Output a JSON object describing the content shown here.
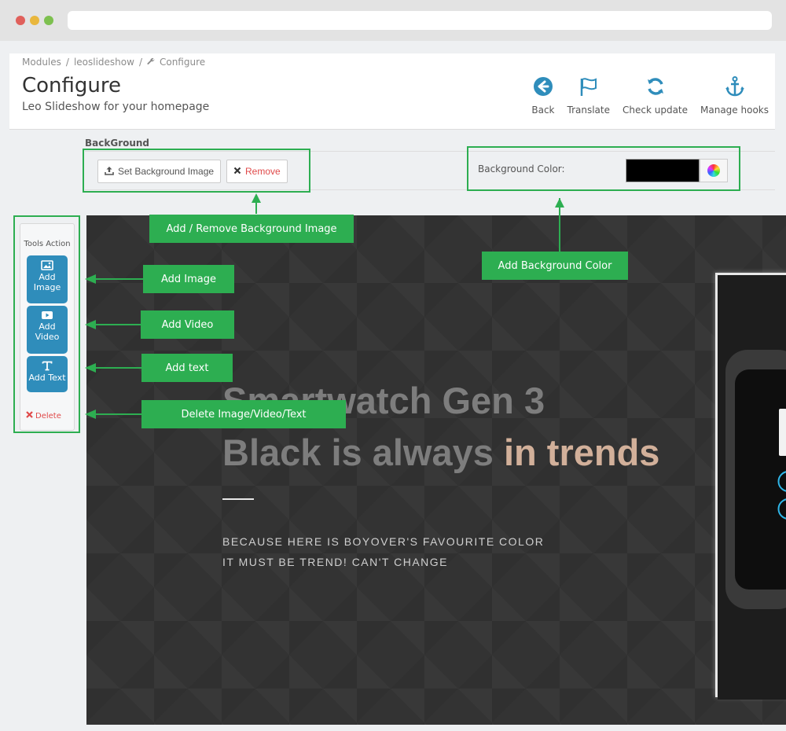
{
  "breadcrumb": {
    "items": [
      "Modules",
      "leoslideshow"
    ],
    "current": "Configure"
  },
  "page": {
    "title": "Configure",
    "subtitle": "Leo Slideshow for your homepage"
  },
  "toolbar": {
    "back": "Back",
    "translate": "Translate",
    "check_update": "Check update",
    "manage_hooks": "Manage hooks"
  },
  "background": {
    "section_title": "BackGround",
    "set_image_label": "Set Background Image",
    "remove_label": "Remove",
    "color_label": "Background Color:",
    "color_value": "#000000"
  },
  "tools": {
    "title": "Tools Action",
    "add_image": "Add Image",
    "add_video": "Add Video",
    "add_text": "Add Text",
    "delete": "Delete"
  },
  "slide": {
    "heading1": "Smartwatch Gen 3",
    "heading2_plain": "Black is always",
    "heading2_accent": "in trends",
    "line1": "BECAUSE HERE IS BOYOVER'S FAVOURITE COLOR",
    "line2": "IT MUST BE TREND! CAN'T CHANGE"
  },
  "annotations": {
    "add_remove_bg": "Add / Remove Background Image",
    "add_bg_color": "Add Background Color",
    "add_image": "Add Image",
    "add_video": "Add Video",
    "add_text": "Add text",
    "delete": "Delete Image/Video/Text"
  },
  "colors": {
    "accent_blue": "#2f8dbb",
    "annotation_green": "#2dae51",
    "danger": "#e04a4a",
    "slide_accent": "#d2b09a"
  }
}
